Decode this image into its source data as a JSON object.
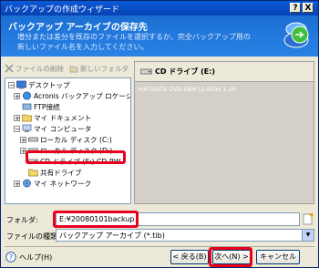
{
  "window": {
    "title": "バックアップの作成ウィザード",
    "help_glyph": "?",
    "close_glyph": "X"
  },
  "header": {
    "title": "バックアップ アーカイブの保存先",
    "description": "増分または差分を既存のファイルを選択するか、完全バックアップ用の新しいファイル名を入力してください。"
  },
  "toolbar": {
    "delete_label": "ファイルの削除",
    "new_folder_label": "新しいフォルダ"
  },
  "tree": {
    "items": [
      {
        "label": "デスクトップ"
      },
      {
        "label": "Acronis バックアップ ロケーション"
      },
      {
        "label": "FTP接続"
      },
      {
        "label": "マイ ドキュメント"
      },
      {
        "label": "マイ コンピュータ"
      },
      {
        "label": "ローカル ディスク (C:)"
      },
      {
        "label": "ローカル ディスク (D:)"
      },
      {
        "label": "CD ドライブ (E:) CD-RW"
      },
      {
        "label": "共有ドライブ"
      },
      {
        "label": "マイ ネットワーク"
      }
    ]
  },
  "details": {
    "title": "CD ドライブ (E:)",
    "device": "MATSHITA DVD-RAM UJ-850S 1.20"
  },
  "folder": {
    "label": "フォルダ:",
    "value": "E:¥20080101backup"
  },
  "filetype": {
    "label": "ファイルの種類(T):",
    "value": "バックアップ アーカイブ (*.tib)"
  },
  "buttons": {
    "help": "ヘルプ(H)",
    "back": "< 戻る(B)",
    "next": "次へ(N) >",
    "cancel": "キャンセル"
  },
  "colors": {
    "titlebar": "#0842b4",
    "header": "#1b6fd4",
    "highlight": "#e8001c"
  }
}
